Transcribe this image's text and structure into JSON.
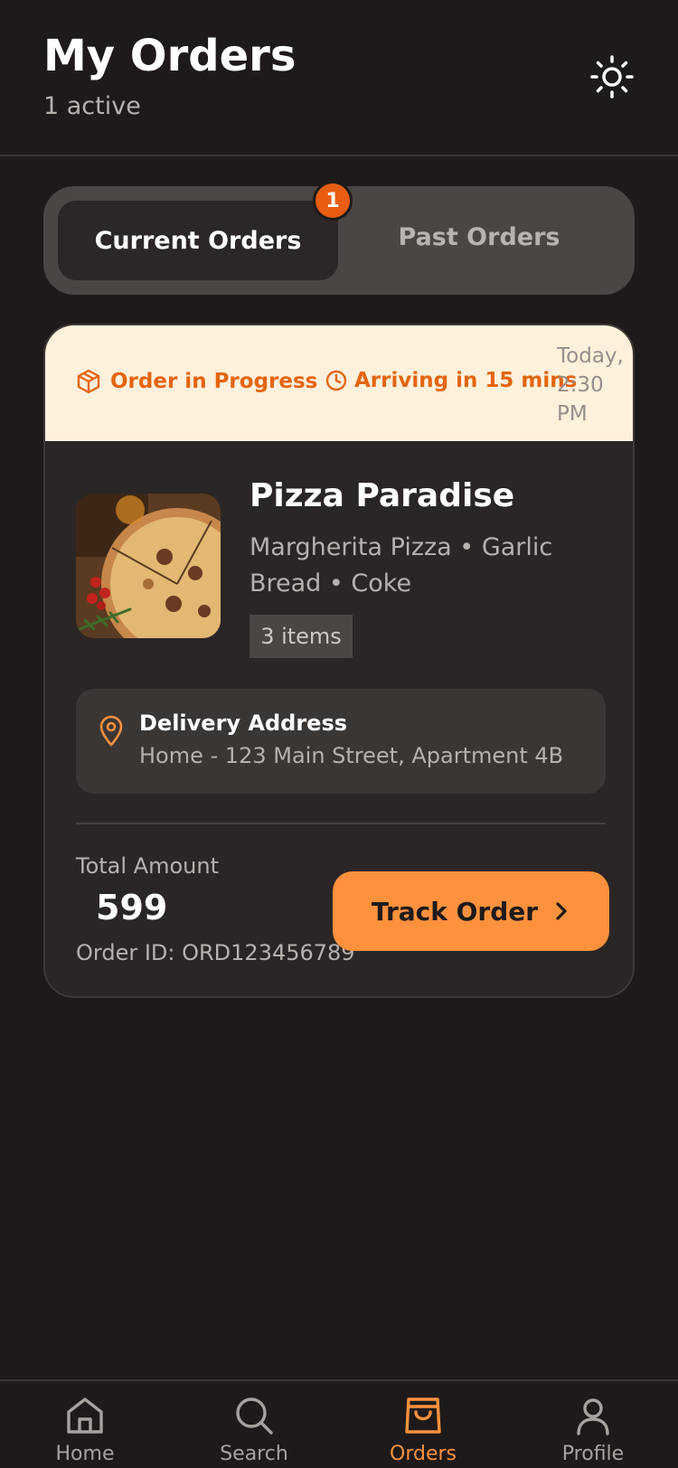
{
  "header": {
    "title": "My Orders",
    "subtitle": "1 active"
  },
  "tabs": {
    "current_label": "Current Orders",
    "past_label": "Past Orders",
    "current_badge": "1"
  },
  "order": {
    "status": "Order in Progress",
    "eta": "Arriving in 15 mins",
    "time": "Today, 2:30 PM",
    "restaurant": "Pizza Paradise",
    "items_desc": "Margherita Pizza • Garlic Bread • Coke",
    "items_count": "3 items",
    "address_title": "Delivery Address",
    "address": "Home - 123 Main Street, Apartment 4B",
    "total_label": "Total Amount",
    "total_amount": "599",
    "order_id": "Order ID: ORD123456789",
    "track_label": "Track Order"
  },
  "nav": {
    "items": [
      {
        "label": "Home",
        "icon": "home-icon"
      },
      {
        "label": "Search",
        "icon": "search-icon"
      },
      {
        "label": "Orders",
        "icon": "shopping-bag-icon",
        "active": true
      },
      {
        "label": "Profile",
        "icon": "user-icon"
      }
    ]
  },
  "colors": {
    "accent": "#fd913e",
    "status_text": "#e5650f",
    "status_bg": "#fff1dc",
    "background": "#1e1a19",
    "card": "#2a2625"
  }
}
